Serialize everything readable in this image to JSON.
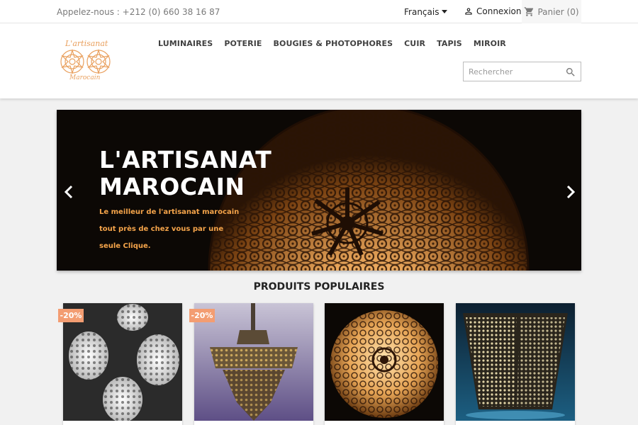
{
  "topbar": {
    "phone": "Appelez-nous : +212 (0) 660 38 16 87",
    "language": "Français",
    "login": "Connexion",
    "cart_label": "Panier (0)"
  },
  "header": {
    "logo_line1": "L'artisanat",
    "logo_line2": "Marocain",
    "nav": [
      "LUMINAIRES",
      "POTERIE",
      "BOUGIES & PHOTOPHORES",
      "CUIR",
      "TAPIS",
      "MIROIR"
    ],
    "search_placeholder": "Rechercher"
  },
  "hero": {
    "title": "L'ARTISANAT MAROCAIN",
    "subtitle": "Le meilleur de l'artisanat marocain tout près de chez vous par une seule Clique."
  },
  "products": {
    "section_title": "PRODUITS POPULAIRES",
    "discount_badge_1": "-20%",
    "discount_badge_2": "-20%"
  },
  "colors": {
    "accent": "#f5a44a",
    "badge": "#f39d72",
    "logo": "#e9a05e"
  }
}
